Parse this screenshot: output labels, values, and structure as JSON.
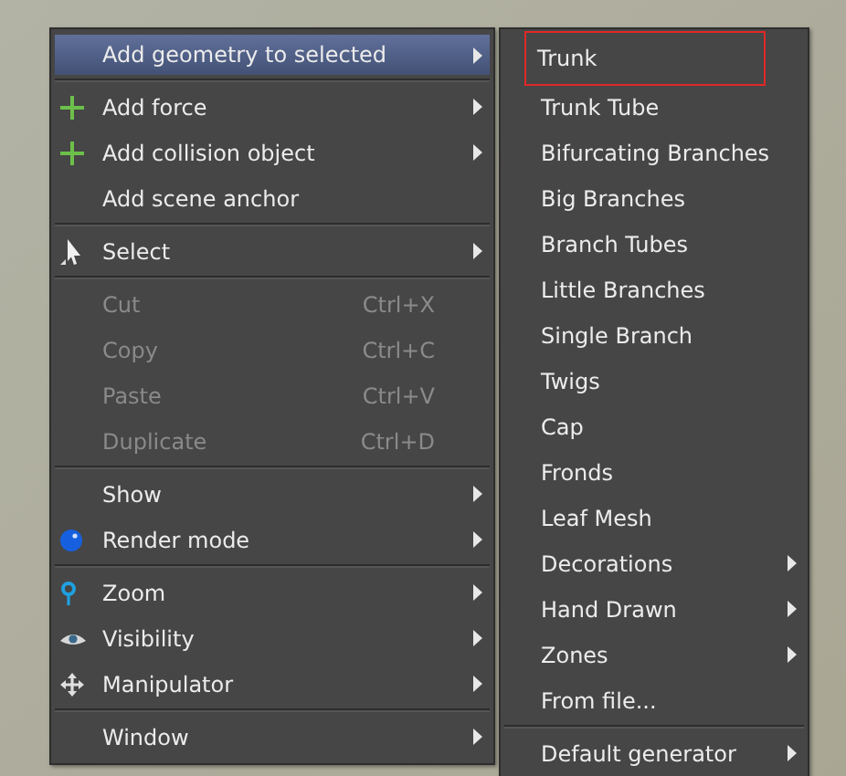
{
  "context_menu": {
    "sections": [
      [
        {
          "label": "Add geometry to selected",
          "selected": true,
          "disabled": false,
          "submenu": true
        }
      ],
      [
        {
          "label": "Add force",
          "kind": "add",
          "selected": false,
          "disabled": false,
          "submenu": true
        },
        {
          "label": "Add collision object",
          "kind": "add",
          "selected": false,
          "disabled": false,
          "submenu": true
        },
        {
          "label": "Add scene anchor",
          "selected": false,
          "disabled": false,
          "submenu": false
        }
      ],
      [
        {
          "label": "Select",
          "kind": "select",
          "selected": false,
          "disabled": false,
          "submenu": true
        }
      ],
      [
        {
          "label": "Cut",
          "shortcut": "Ctrl+X",
          "selected": false,
          "disabled": true,
          "submenu": false
        },
        {
          "label": "Copy",
          "shortcut": "Ctrl+C",
          "selected": false,
          "disabled": true,
          "submenu": false
        },
        {
          "label": "Paste",
          "shortcut": "Ctrl+V",
          "selected": false,
          "disabled": true,
          "submenu": false
        },
        {
          "label": "Duplicate",
          "shortcut": "Ctrl+D",
          "selected": false,
          "disabled": true,
          "submenu": false
        }
      ],
      [
        {
          "label": "Show",
          "selected": false,
          "disabled": false,
          "submenu": true
        },
        {
          "label": "Render mode",
          "kind": "render",
          "selected": false,
          "disabled": false,
          "submenu": true
        }
      ],
      [
        {
          "label": "Zoom",
          "kind": "zoom",
          "selected": false,
          "disabled": false,
          "submenu": true
        },
        {
          "label": "Visibility",
          "kind": "visibility",
          "selected": false,
          "disabled": false,
          "submenu": true
        },
        {
          "label": "Manipulator",
          "kind": "manipulator",
          "selected": false,
          "disabled": false,
          "submenu": true
        }
      ],
      [
        {
          "label": "Window",
          "selected": false,
          "disabled": false,
          "submenu": true
        }
      ]
    ]
  },
  "geometry_submenu": {
    "sections": [
      [
        {
          "label": "Trunk",
          "selected": true,
          "submenu": false
        },
        {
          "label": "Trunk Tube",
          "selected": false,
          "submenu": false
        },
        {
          "label": "Bifurcating Branches",
          "selected": false,
          "submenu": false
        },
        {
          "label": "Big Branches",
          "selected": false,
          "submenu": false
        },
        {
          "label": "Branch Tubes",
          "selected": false,
          "submenu": false
        },
        {
          "label": "Little Branches",
          "selected": false,
          "submenu": false
        },
        {
          "label": "Single Branch",
          "selected": false,
          "submenu": false
        },
        {
          "label": "Twigs",
          "selected": false,
          "submenu": false
        },
        {
          "label": "Cap",
          "selected": false,
          "submenu": false
        },
        {
          "label": "Fronds",
          "selected": false,
          "submenu": false
        },
        {
          "label": "Leaf Mesh",
          "selected": false,
          "submenu": false
        },
        {
          "label": "Decorations",
          "selected": false,
          "submenu": true
        },
        {
          "label": "Hand Drawn",
          "selected": false,
          "submenu": true
        },
        {
          "label": "Zones",
          "selected": false,
          "submenu": true
        },
        {
          "label": "From file...",
          "selected": false,
          "submenu": false
        }
      ],
      [
        {
          "label": "Default generator",
          "selected": false,
          "submenu": true
        }
      ]
    ]
  }
}
